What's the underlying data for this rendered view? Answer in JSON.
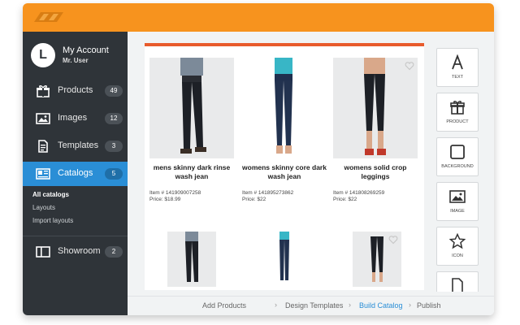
{
  "account": {
    "initial": "L",
    "name": "My Account",
    "user": "Mr. User"
  },
  "nav": [
    {
      "label": "Products",
      "count": "49",
      "icon": "gift-icon"
    },
    {
      "label": "Images",
      "count": "12",
      "icon": "image-icon"
    },
    {
      "label": "Templates",
      "count": "3",
      "icon": "document-icon"
    },
    {
      "label": "Catalogs",
      "count": "5",
      "icon": "catalog-icon"
    },
    {
      "label": "Showroom",
      "count": "2",
      "icon": "showroom-icon"
    }
  ],
  "subnav": [
    "All catalogs",
    "Layouts",
    "Import layouts"
  ],
  "products": [
    {
      "name": "mens skinny dark rinse wash jean",
      "item": "Item # 141909007258",
      "price": "Price: $18.99"
    },
    {
      "name": "womens skinny core dark wash jean",
      "item": "Item # 141895273862",
      "price": "Price: $22"
    },
    {
      "name": "womens solid crop leggings",
      "item": "Item # 141808269259",
      "price": "Price: $22"
    }
  ],
  "tools": [
    "TEXT",
    "PRODUCT",
    "BACKGROUND",
    "IMAGE",
    "ICON"
  ],
  "breadcrumb": [
    "Add Products",
    "Design Templates",
    "Build Catalog",
    "Publish"
  ],
  "colors": {
    "accent": "#f7931e",
    "active": "#2a8ed6",
    "sidebar": "#2f3439",
    "canvas_top": "#e85b2c"
  }
}
